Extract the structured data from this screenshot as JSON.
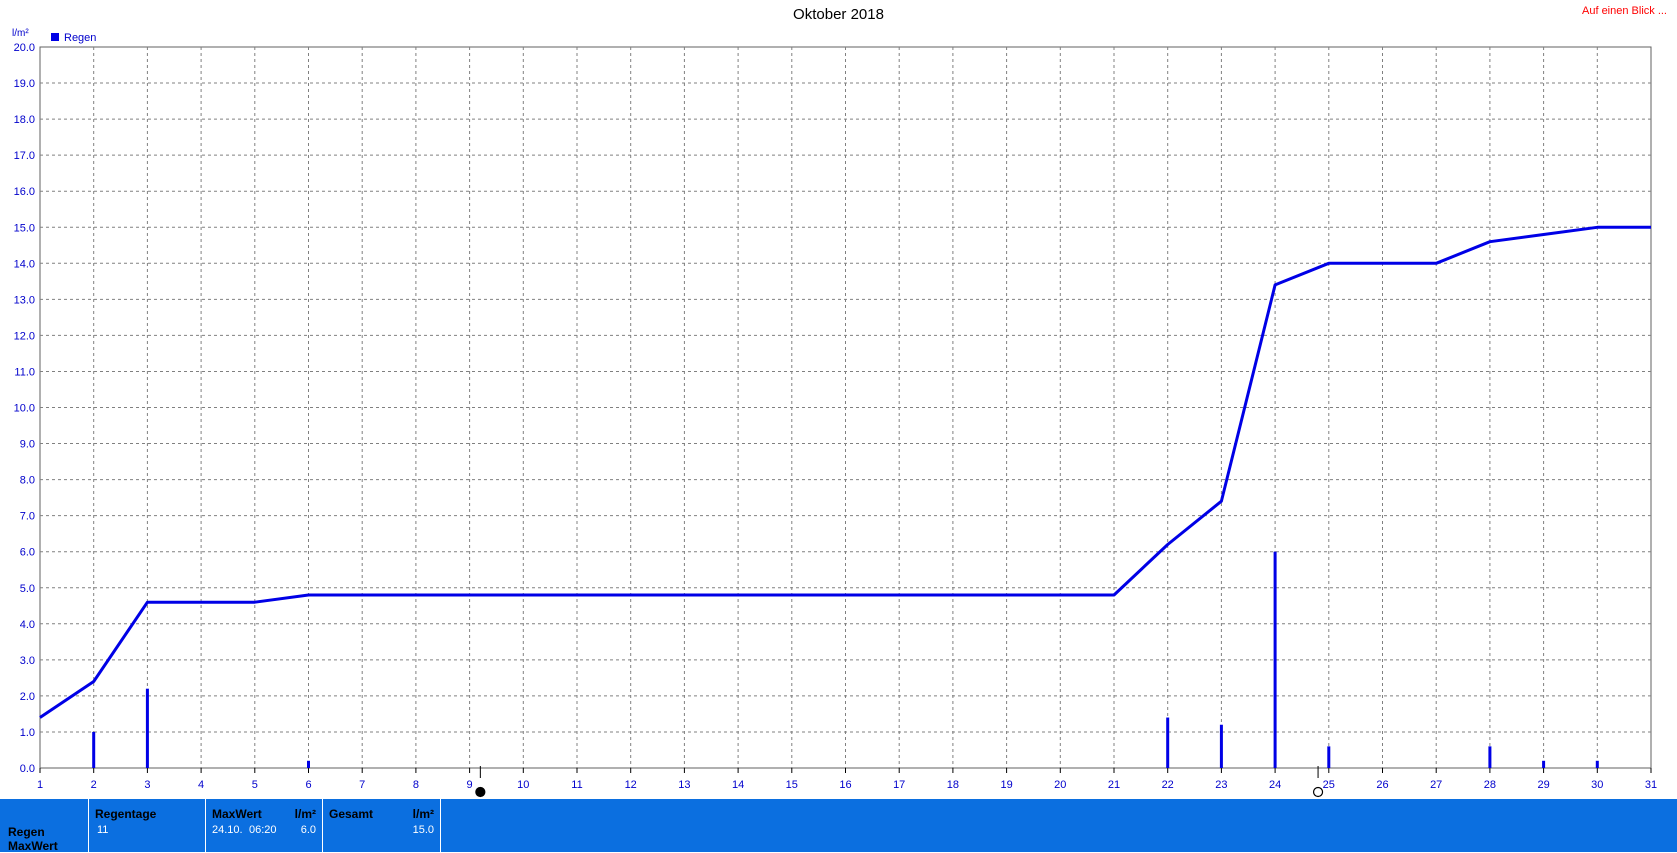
{
  "title": "Oktober 2018",
  "link_label": "Auf einen Blick ...",
  "colors": {
    "series": "#0000e6",
    "grid": "#808080",
    "axis_text": "#0000cc",
    "footer_bg": "#0b6fe0",
    "link": "#ff0000"
  },
  "chart_data": {
    "type": "bar+line",
    "yunit": "l/m²",
    "ylim": [
      0,
      20
    ],
    "yticks": [
      "0.0",
      "1.0",
      "2.0",
      "3.0",
      "4.0",
      "5.0",
      "6.0",
      "7.0",
      "8.0",
      "9.0",
      "10.0",
      "11.0",
      "12.0",
      "13.0",
      "14.0",
      "15.0",
      "16.0",
      "17.0",
      "18.0",
      "19.0",
      "20.0"
    ],
    "xlim": [
      1,
      31
    ],
    "xticks": [
      "1",
      "2",
      "3",
      "4",
      "5",
      "6",
      "7",
      "8",
      "9",
      "10",
      "11",
      "12",
      "13",
      "14",
      "15",
      "16",
      "17",
      "18",
      "19",
      "20",
      "21",
      "22",
      "23",
      "24",
      "25",
      "26",
      "27",
      "28",
      "29",
      "30",
      "31"
    ],
    "grid": true,
    "legend": {
      "position": "top-left",
      "label": "Regen"
    },
    "bars": [
      {
        "x": 2,
        "value": 1.0
      },
      {
        "x": 3,
        "value": 2.2
      },
      {
        "x": 6,
        "value": 0.2
      },
      {
        "x": 22,
        "value": 1.4
      },
      {
        "x": 23,
        "value": 1.2
      },
      {
        "x": 24,
        "value": 6.0
      },
      {
        "x": 25,
        "value": 0.6
      },
      {
        "x": 28,
        "value": 0.6
      },
      {
        "x": 29,
        "value": 0.2
      },
      {
        "x": 30,
        "value": 0.2
      }
    ],
    "cumulative": [
      {
        "x": 1,
        "y": 1.4
      },
      {
        "x": 2,
        "y": 2.4
      },
      {
        "x": 3,
        "y": 4.6
      },
      {
        "x": 5,
        "y": 4.6
      },
      {
        "x": 6,
        "y": 4.8
      },
      {
        "x": 21,
        "y": 4.8
      },
      {
        "x": 22,
        "y": 6.2
      },
      {
        "x": 23,
        "y": 7.4
      },
      {
        "x": 24,
        "y": 13.4
      },
      {
        "x": 25,
        "y": 14.0
      },
      {
        "x": 27,
        "y": 14.0
      },
      {
        "x": 28,
        "y": 14.6
      },
      {
        "x": 29,
        "y": 14.8
      },
      {
        "x": 30,
        "y": 15.0
      },
      {
        "x": 31,
        "y": 15.0
      }
    ],
    "moon_markers": [
      {
        "x": 9.2,
        "phase": "full"
      },
      {
        "x": 24.8,
        "phase": "new"
      }
    ]
  },
  "footer": {
    "row_labels": [
      "Regen",
      "MaxWert"
    ],
    "regentage": {
      "header": "Regentage",
      "value": "11"
    },
    "maxwert": {
      "header": "MaxWert",
      "unit": "l/m²",
      "date": "24.10.",
      "time": "06:20",
      "value": "6.0"
    },
    "gesamt": {
      "header": "Gesamt",
      "unit": "l/m²",
      "value": "15.0"
    }
  }
}
